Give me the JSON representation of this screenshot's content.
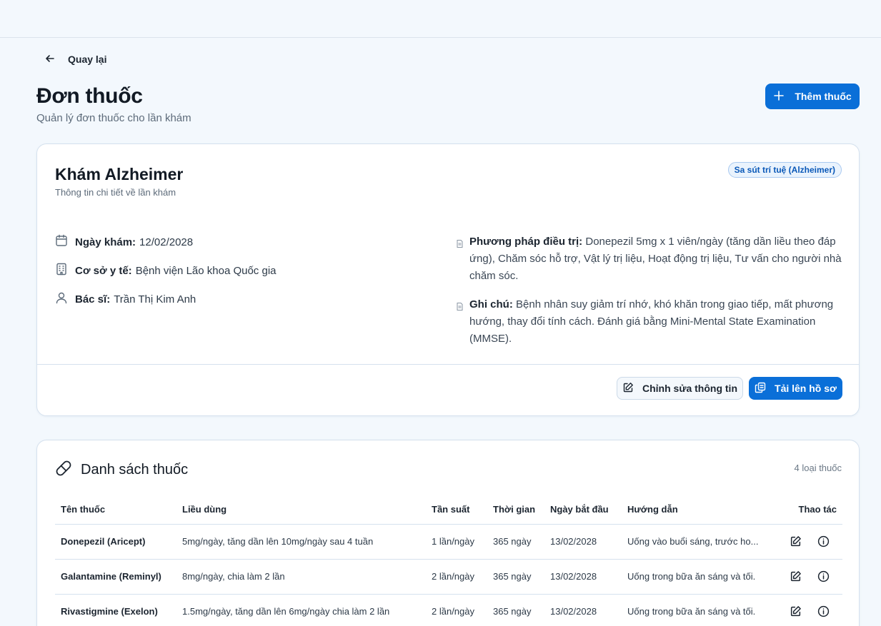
{
  "nav": {
    "back_label": "Quay lại"
  },
  "header": {
    "title": "Đơn thuốc",
    "subtitle": "Quản lý đơn thuốc cho lần khám",
    "add_button": "Thêm thuốc"
  },
  "exam": {
    "title": "Khám Alzheimer",
    "subtitle": "Thông tin chi tiết về lần khám",
    "tag": "Sa sút trí tuệ (Alzheimer)",
    "date_label": "Ngày khám:",
    "date_value": "12/02/2028",
    "facility_label": "Cơ sở y tế:",
    "facility_value": "Bệnh viện Lão khoa Quốc gia",
    "doctor_label": "Bác sĩ:",
    "doctor_value": "Trần Thị Kim Anh",
    "treatment_label": "Phương pháp điều trị:",
    "treatment_value": "Donepezil 5mg x 1 viên/ngày (tăng dần liều theo đáp ứng), Chăm sóc hỗ trợ, Vật lý trị liệu, Hoạt động trị liệu, Tư vấn cho người nhà chăm sóc.",
    "note_label": "Ghi chú:",
    "note_value": "Bệnh nhân suy giảm trí nhớ, khó khăn trong giao tiếp, mất phương hướng, thay đổi tính cách. Đánh giá bằng Mini-Mental State Examination (MMSE).",
    "edit_button": "Chỉnh sửa thông tin",
    "upload_button": "Tải lên hồ sơ"
  },
  "medications": {
    "title": "Danh sách thuốc",
    "count": "4 loại thuốc",
    "columns": [
      "Tên thuốc",
      "Liều dùng",
      "Tần suất",
      "Thời gian",
      "Ngày bắt đầu",
      "Hướng dẫn",
      "Thao tác"
    ],
    "rows": [
      {
        "name": "Donepezil (Aricept)",
        "dose": "5mg/ngày, tăng dần lên 10mg/ngày sau 4 tuần",
        "freq": "1 lần/ngày",
        "duration": "365 ngày",
        "start": "13/02/2028",
        "guide": "Uống vào buổi sáng, trước ho..."
      },
      {
        "name": "Galantamine (Reminyl)",
        "dose": "8mg/ngày, chia làm 2 lần",
        "freq": "2 lần/ngày",
        "duration": "365 ngày",
        "start": "13/02/2028",
        "guide": "Uống trong bữa ăn sáng và tối."
      },
      {
        "name": "Rivastigmine (Exelon)",
        "dose": "1.5mg/ngày, tăng dần lên 6mg/ngày chia làm 2 lần",
        "freq": "2 lần/ngày",
        "duration": "365 ngày",
        "start": "13/02/2028",
        "guide": "Uống trong bữa ăn sáng và tối."
      }
    ]
  },
  "icons": {
    "back": "arrow-left-icon",
    "add": "plus-icon",
    "date": "calendar-icon",
    "facility": "building-icon",
    "doctor": "user-icon",
    "doc": "document-icon",
    "edit": "edit-icon",
    "upload": "copy-icon",
    "pill": "pill-icon",
    "info": "info-icon"
  },
  "colors": {
    "primary": "#0a6fd8",
    "background": "#f3f8fd",
    "tag_text": "#0a58b8"
  }
}
